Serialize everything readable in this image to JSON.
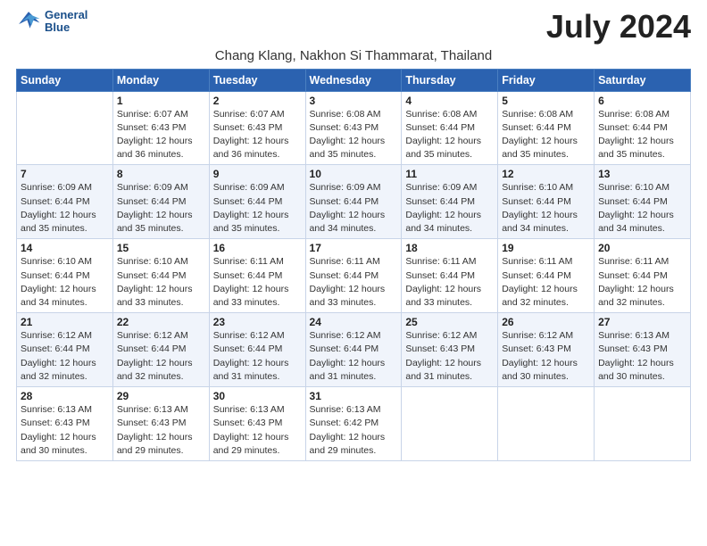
{
  "logo": {
    "line1": "General",
    "line2": "Blue"
  },
  "title": "July 2024",
  "subtitle": "Chang Klang, Nakhon Si Thammarat, Thailand",
  "weekdays": [
    "Sunday",
    "Monday",
    "Tuesday",
    "Wednesday",
    "Thursday",
    "Friday",
    "Saturday"
  ],
  "weeks": [
    [
      {
        "day": "",
        "sunrise": "",
        "sunset": "",
        "daylight": ""
      },
      {
        "day": "1",
        "sunrise": "Sunrise: 6:07 AM",
        "sunset": "Sunset: 6:43 PM",
        "daylight": "Daylight: 12 hours and 36 minutes."
      },
      {
        "day": "2",
        "sunrise": "Sunrise: 6:07 AM",
        "sunset": "Sunset: 6:43 PM",
        "daylight": "Daylight: 12 hours and 36 minutes."
      },
      {
        "day": "3",
        "sunrise": "Sunrise: 6:08 AM",
        "sunset": "Sunset: 6:43 PM",
        "daylight": "Daylight: 12 hours and 35 minutes."
      },
      {
        "day": "4",
        "sunrise": "Sunrise: 6:08 AM",
        "sunset": "Sunset: 6:44 PM",
        "daylight": "Daylight: 12 hours and 35 minutes."
      },
      {
        "day": "5",
        "sunrise": "Sunrise: 6:08 AM",
        "sunset": "Sunset: 6:44 PM",
        "daylight": "Daylight: 12 hours and 35 minutes."
      },
      {
        "day": "6",
        "sunrise": "Sunrise: 6:08 AM",
        "sunset": "Sunset: 6:44 PM",
        "daylight": "Daylight: 12 hours and 35 minutes."
      }
    ],
    [
      {
        "day": "7",
        "sunrise": "Sunrise: 6:09 AM",
        "sunset": "Sunset: 6:44 PM",
        "daylight": "Daylight: 12 hours and 35 minutes."
      },
      {
        "day": "8",
        "sunrise": "Sunrise: 6:09 AM",
        "sunset": "Sunset: 6:44 PM",
        "daylight": "Daylight: 12 hours and 35 minutes."
      },
      {
        "day": "9",
        "sunrise": "Sunrise: 6:09 AM",
        "sunset": "Sunset: 6:44 PM",
        "daylight": "Daylight: 12 hours and 35 minutes."
      },
      {
        "day": "10",
        "sunrise": "Sunrise: 6:09 AM",
        "sunset": "Sunset: 6:44 PM",
        "daylight": "Daylight: 12 hours and 34 minutes."
      },
      {
        "day": "11",
        "sunrise": "Sunrise: 6:09 AM",
        "sunset": "Sunset: 6:44 PM",
        "daylight": "Daylight: 12 hours and 34 minutes."
      },
      {
        "day": "12",
        "sunrise": "Sunrise: 6:10 AM",
        "sunset": "Sunset: 6:44 PM",
        "daylight": "Daylight: 12 hours and 34 minutes."
      },
      {
        "day": "13",
        "sunrise": "Sunrise: 6:10 AM",
        "sunset": "Sunset: 6:44 PM",
        "daylight": "Daylight: 12 hours and 34 minutes."
      }
    ],
    [
      {
        "day": "14",
        "sunrise": "Sunrise: 6:10 AM",
        "sunset": "Sunset: 6:44 PM",
        "daylight": "Daylight: 12 hours and 34 minutes."
      },
      {
        "day": "15",
        "sunrise": "Sunrise: 6:10 AM",
        "sunset": "Sunset: 6:44 PM",
        "daylight": "Daylight: 12 hours and 33 minutes."
      },
      {
        "day": "16",
        "sunrise": "Sunrise: 6:11 AM",
        "sunset": "Sunset: 6:44 PM",
        "daylight": "Daylight: 12 hours and 33 minutes."
      },
      {
        "day": "17",
        "sunrise": "Sunrise: 6:11 AM",
        "sunset": "Sunset: 6:44 PM",
        "daylight": "Daylight: 12 hours and 33 minutes."
      },
      {
        "day": "18",
        "sunrise": "Sunrise: 6:11 AM",
        "sunset": "Sunset: 6:44 PM",
        "daylight": "Daylight: 12 hours and 33 minutes."
      },
      {
        "day": "19",
        "sunrise": "Sunrise: 6:11 AM",
        "sunset": "Sunset: 6:44 PM",
        "daylight": "Daylight: 12 hours and 32 minutes."
      },
      {
        "day": "20",
        "sunrise": "Sunrise: 6:11 AM",
        "sunset": "Sunset: 6:44 PM",
        "daylight": "Daylight: 12 hours and 32 minutes."
      }
    ],
    [
      {
        "day": "21",
        "sunrise": "Sunrise: 6:12 AM",
        "sunset": "Sunset: 6:44 PM",
        "daylight": "Daylight: 12 hours and 32 minutes."
      },
      {
        "day": "22",
        "sunrise": "Sunrise: 6:12 AM",
        "sunset": "Sunset: 6:44 PM",
        "daylight": "Daylight: 12 hours and 32 minutes."
      },
      {
        "day": "23",
        "sunrise": "Sunrise: 6:12 AM",
        "sunset": "Sunset: 6:44 PM",
        "daylight": "Daylight: 12 hours and 31 minutes."
      },
      {
        "day": "24",
        "sunrise": "Sunrise: 6:12 AM",
        "sunset": "Sunset: 6:44 PM",
        "daylight": "Daylight: 12 hours and 31 minutes."
      },
      {
        "day": "25",
        "sunrise": "Sunrise: 6:12 AM",
        "sunset": "Sunset: 6:43 PM",
        "daylight": "Daylight: 12 hours and 31 minutes."
      },
      {
        "day": "26",
        "sunrise": "Sunrise: 6:12 AM",
        "sunset": "Sunset: 6:43 PM",
        "daylight": "Daylight: 12 hours and 30 minutes."
      },
      {
        "day": "27",
        "sunrise": "Sunrise: 6:13 AM",
        "sunset": "Sunset: 6:43 PM",
        "daylight": "Daylight: 12 hours and 30 minutes."
      }
    ],
    [
      {
        "day": "28",
        "sunrise": "Sunrise: 6:13 AM",
        "sunset": "Sunset: 6:43 PM",
        "daylight": "Daylight: 12 hours and 30 minutes."
      },
      {
        "day": "29",
        "sunrise": "Sunrise: 6:13 AM",
        "sunset": "Sunset: 6:43 PM",
        "daylight": "Daylight: 12 hours and 29 minutes."
      },
      {
        "day": "30",
        "sunrise": "Sunrise: 6:13 AM",
        "sunset": "Sunset: 6:43 PM",
        "daylight": "Daylight: 12 hours and 29 minutes."
      },
      {
        "day": "31",
        "sunrise": "Sunrise: 6:13 AM",
        "sunset": "Sunset: 6:42 PM",
        "daylight": "Daylight: 12 hours and 29 minutes."
      },
      {
        "day": "",
        "sunrise": "",
        "sunset": "",
        "daylight": ""
      },
      {
        "day": "",
        "sunrise": "",
        "sunset": "",
        "daylight": ""
      },
      {
        "day": "",
        "sunrise": "",
        "sunset": "",
        "daylight": ""
      }
    ]
  ]
}
